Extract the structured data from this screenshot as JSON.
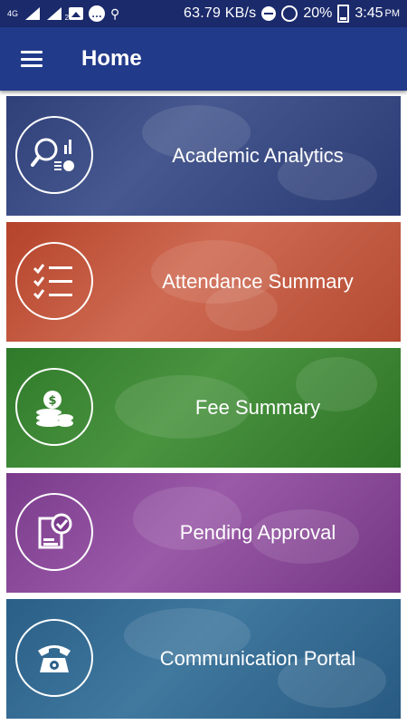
{
  "status_bar": {
    "network_type": "4G",
    "sim_label": "2",
    "speed": "63.79 KB/s",
    "battery": "20%",
    "time": "3:45",
    "ampm": "PM"
  },
  "app_bar": {
    "title": "Home",
    "menu_icon": "hamburger-menu-icon"
  },
  "cards": [
    {
      "label": "Academic Analytics",
      "icon": "analytics-search-icon",
      "color": "#2f3f78"
    },
    {
      "label": "Attendance Summary",
      "icon": "checklist-icon",
      "color": "#b4432a"
    },
    {
      "label": "Fee Summary",
      "icon": "coins-icon",
      "color": "#2f7a2a"
    },
    {
      "label": "Pending Approval",
      "icon": "approval-document-icon",
      "color": "#7b3b8c"
    },
    {
      "label": "Communication Portal",
      "icon": "telephone-icon",
      "color": "#2a5f88"
    }
  ]
}
